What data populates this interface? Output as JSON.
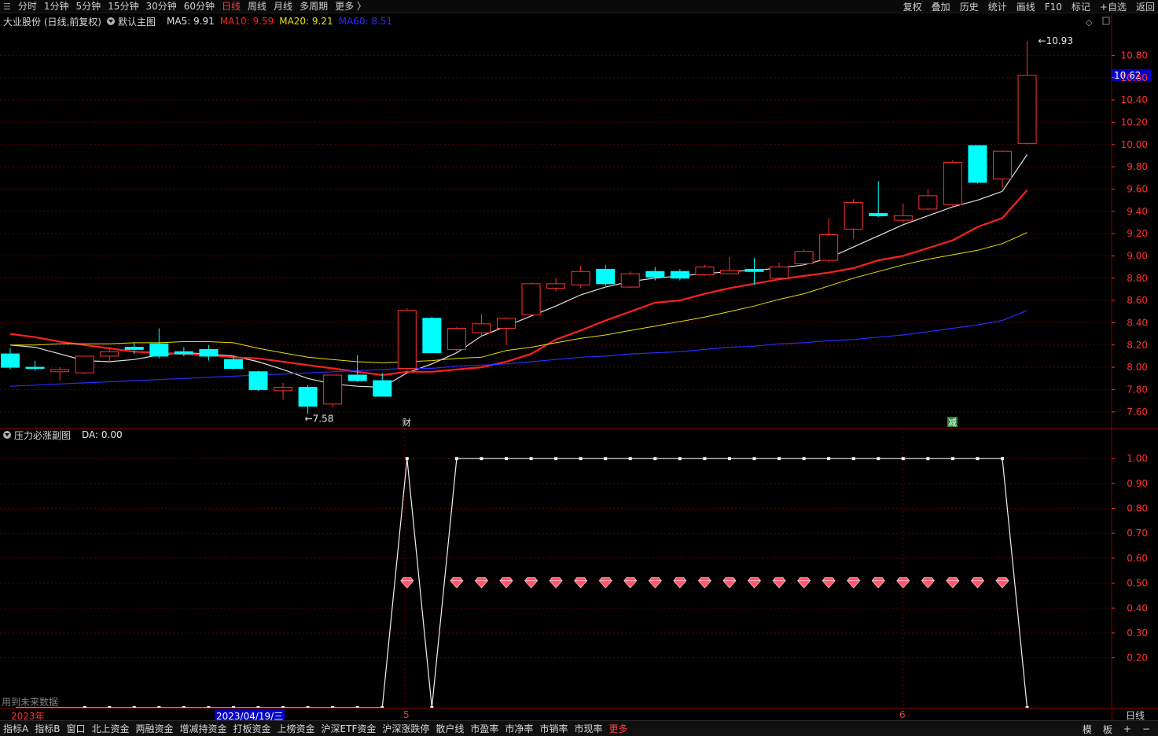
{
  "toolbar": {
    "tabs": [
      "分时",
      "1分钟",
      "5分钟",
      "15分钟",
      "30分钟",
      "60分钟",
      "日线",
      "周线",
      "月线",
      "多周期",
      "更多 〉"
    ],
    "active_tab": "日线",
    "right_buttons": [
      "复权",
      "叠加",
      "历史",
      "统计",
      "画线",
      "F10",
      "标记",
      "+自选",
      "返回"
    ]
  },
  "main_panel": {
    "stock_label": "大业股份 (日线,前复权)",
    "template_label": "默认主图",
    "ma_labels": [
      {
        "text": "MA5: 9.91",
        "color": "#e0e0e0"
      },
      {
        "text": "MA10: 9.59",
        "color": "#ff2020"
      },
      {
        "text": "MA20: 9.21",
        "color": "#e8e000"
      },
      {
        "text": "MA60: 8.51",
        "color": "#2b2bff"
      }
    ],
    "high_marker": "10.93",
    "low_marker": "7.58",
    "current_price_tag": "10.62",
    "event_marks": [
      "财",
      "减"
    ]
  },
  "sub_panel": {
    "indicator_label": "压力必涨副图",
    "value_label": "DA: 0.00",
    "future_data_note": "用到未来数据"
  },
  "x_axis": {
    "year_label": "2023年",
    "date_label": "2023/04/19/三",
    "month_labels": [
      "5",
      "6"
    ],
    "period_label": "日线"
  },
  "bottombar": {
    "items": [
      "指标A",
      "指标B",
      "窗口",
      "北上资金",
      "两融资金",
      "增减持资金",
      "打板资金",
      "上榜资金",
      "沪深ETF资金",
      "沪深涨跌停",
      "散户线",
      "市盈率",
      "市净率",
      "市销率",
      "市现率",
      "更多"
    ],
    "highlight_item": "更多",
    "right_controls": [
      "模",
      "板",
      "+",
      "−"
    ]
  },
  "colors": {
    "up": "#ff3030",
    "down": "#00ffff",
    "ma5": "#e0e0e0",
    "ma10": "#ff2020",
    "ma20": "#e8e000",
    "ma60": "#2b2bff",
    "grid": "#5a0000",
    "axis_text": "#ff3030",
    "price_tag_bg": "#0000c8"
  },
  "chart_data": [
    {
      "type": "candlestick",
      "price_axis_ticks": [
        "10.80",
        "10.60",
        "10.40",
        "10.20",
        "10.00",
        "9.80",
        "9.60",
        "9.40",
        "9.20",
        "9.00",
        "8.80",
        "8.60",
        "8.40",
        "8.20",
        "8.00",
        "7.80",
        "7.60"
      ],
      "ylim": [
        7.45,
        11.05
      ],
      "candles": [
        [
          8.12,
          8.17,
          7.98,
          8.0
        ],
        [
          8.0,
          8.06,
          7.97,
          7.99
        ],
        [
          7.96,
          8.0,
          7.88,
          7.98
        ],
        [
          7.95,
          8.1,
          7.94,
          8.1
        ],
        [
          8.1,
          8.18,
          8.04,
          8.14
        ],
        [
          8.18,
          8.22,
          8.12,
          8.16
        ],
        [
          8.21,
          8.35,
          8.08,
          8.1
        ],
        [
          8.14,
          8.18,
          8.1,
          8.12
        ],
        [
          8.16,
          8.2,
          8.06,
          8.1
        ],
        [
          8.07,
          8.1,
          7.98,
          7.99
        ],
        [
          7.96,
          7.97,
          7.79,
          7.8
        ],
        [
          7.79,
          7.86,
          7.71,
          7.82
        ],
        [
          7.82,
          7.84,
          7.58,
          7.65
        ],
        [
          7.67,
          7.93,
          7.64,
          7.93
        ],
        [
          7.93,
          8.11,
          7.87,
          7.88
        ],
        [
          7.88,
          7.95,
          7.74,
          7.74
        ],
        [
          7.99,
          8.53,
          7.96,
          8.51
        ],
        [
          8.44,
          8.45,
          8.13,
          8.13
        ],
        [
          8.16,
          8.36,
          8.14,
          8.35
        ],
        [
          8.31,
          8.48,
          8.28,
          8.39
        ],
        [
          8.35,
          8.45,
          8.2,
          8.44
        ],
        [
          8.47,
          8.76,
          8.46,
          8.75
        ],
        [
          8.71,
          8.8,
          8.68,
          8.75
        ],
        [
          8.74,
          8.91,
          8.71,
          8.86
        ],
        [
          8.88,
          8.92,
          8.73,
          8.75
        ],
        [
          8.72,
          8.86,
          8.71,
          8.84
        ],
        [
          8.86,
          8.9,
          8.78,
          8.81
        ],
        [
          8.86,
          8.88,
          8.78,
          8.8
        ],
        [
          8.83,
          8.92,
          8.82,
          8.9
        ],
        [
          8.84,
          8.99,
          8.84,
          8.87
        ],
        [
          8.88,
          8.98,
          8.74,
          8.86
        ],
        [
          8.8,
          8.94,
          8.8,
          8.9
        ],
        [
          8.93,
          9.06,
          8.92,
          9.04
        ],
        [
          8.96,
          9.34,
          8.94,
          9.19
        ],
        [
          9.24,
          9.51,
          9.15,
          9.48
        ],
        [
          9.38,
          9.67,
          9.35,
          9.36
        ],
        [
          9.32,
          9.47,
          9.29,
          9.36
        ],
        [
          9.42,
          9.6,
          9.41,
          9.54
        ],
        [
          9.46,
          9.86,
          9.43,
          9.84
        ],
        [
          9.99,
          9.99,
          9.65,
          9.66
        ],
        [
          9.69,
          9.94,
          9.61,
          9.94
        ],
        [
          10.01,
          10.93,
          10.0,
          10.62
        ]
      ],
      "ma_series": [
        {
          "name": "MA5",
          "values": [
            8.2,
            8.18,
            8.12,
            8.06,
            8.05,
            8.07,
            8.11,
            8.13,
            8.12,
            8.1,
            8.05,
            7.98,
            7.9,
            7.85,
            7.83,
            7.82,
            7.95,
            8.03,
            8.13,
            8.28,
            8.37,
            8.46,
            8.55,
            8.65,
            8.72,
            8.77,
            8.8,
            8.82,
            8.84,
            8.86,
            8.87,
            8.89,
            8.92,
            8.98,
            9.08,
            9.18,
            9.28,
            9.36,
            9.44,
            9.5,
            9.58,
            9.91
          ]
        },
        {
          "name": "MA10",
          "values": [
            8.3,
            8.27,
            8.23,
            8.2,
            8.17,
            8.14,
            8.13,
            8.12,
            8.11,
            8.09,
            8.08,
            8.05,
            8.02,
            7.99,
            7.96,
            7.93,
            7.96,
            7.96,
            7.98,
            8.0,
            8.05,
            8.12,
            8.25,
            8.33,
            8.42,
            8.5,
            8.58,
            8.6,
            8.66,
            8.71,
            8.75,
            8.79,
            8.82,
            8.85,
            8.89,
            8.96,
            9.0,
            9.07,
            9.14,
            9.26,
            9.34,
            9.59
          ]
        },
        {
          "name": "MA20",
          "values": [
            8.2,
            8.2,
            8.21,
            8.21,
            8.21,
            8.22,
            8.22,
            8.23,
            8.23,
            8.22,
            8.17,
            8.13,
            8.09,
            8.07,
            8.05,
            8.04,
            8.05,
            8.06,
            8.08,
            8.09,
            8.15,
            8.18,
            8.22,
            8.26,
            8.29,
            8.33,
            8.37,
            8.41,
            8.45,
            8.5,
            8.55,
            8.61,
            8.66,
            8.73,
            8.8,
            8.86,
            8.92,
            8.97,
            9.01,
            9.05,
            9.11,
            9.21
          ]
        },
        {
          "name": "MA60",
          "values": [
            7.83,
            7.84,
            7.85,
            7.86,
            7.87,
            7.88,
            7.89,
            7.9,
            7.91,
            7.92,
            7.93,
            7.94,
            7.95,
            7.96,
            7.97,
            7.98,
            7.99,
            7.99,
            8.01,
            8.02,
            8.03,
            8.05,
            8.07,
            8.09,
            8.1,
            8.12,
            8.13,
            8.14,
            8.16,
            8.18,
            8.19,
            8.21,
            8.22,
            8.24,
            8.25,
            8.27,
            8.29,
            8.32,
            8.35,
            8.38,
            8.42,
            8.51
          ]
        }
      ]
    },
    {
      "type": "line",
      "series": [
        {
          "name": "DA",
          "values": [
            0,
            0,
            0,
            0,
            0,
            0,
            0,
            0,
            0,
            0,
            0,
            0,
            0,
            0,
            0,
            0,
            1,
            0,
            1,
            1,
            1,
            1,
            1,
            1,
            1,
            1,
            1,
            1,
            1,
            1,
            1,
            1,
            1,
            1,
            1,
            1,
            1,
            1,
            1,
            1,
            1,
            0
          ]
        }
      ],
      "signal_value": 0.5,
      "axis_ticks": [
        "1.00",
        "0.90",
        "0.80",
        "0.70",
        "0.60",
        "0.50",
        "0.40",
        "0.30",
        "0.20"
      ],
      "ylim": [
        0,
        1.07
      ]
    }
  ]
}
